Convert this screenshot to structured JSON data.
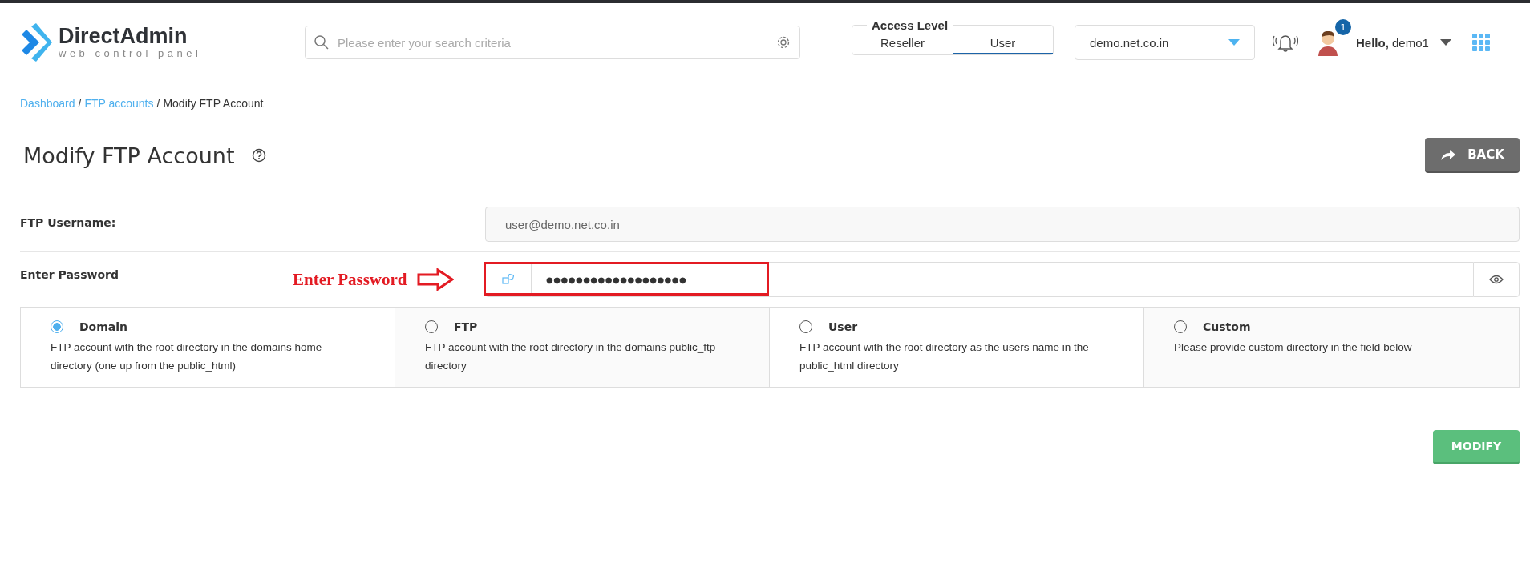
{
  "header": {
    "logo": {
      "name": "DirectAdmin",
      "tagline": "web control panel"
    },
    "search": {
      "placeholder": "Please enter your search criteria"
    },
    "access_level": {
      "title": "Access Level",
      "tabs": [
        {
          "label": "Reseller",
          "selected": false
        },
        {
          "label": "User",
          "selected": true
        }
      ]
    },
    "domain_select": {
      "value": "demo.net.co.in"
    },
    "notification_count": "1",
    "greeting": {
      "prefix": "Hello,",
      "user": "demo1"
    }
  },
  "breadcrumb": {
    "separator": "/",
    "items": [
      {
        "label": "Dashboard",
        "kind": "link"
      },
      {
        "label": "FTP accounts",
        "kind": "link"
      },
      {
        "label": "Modify FTP Account",
        "kind": "current"
      }
    ]
  },
  "page": {
    "title": "Modify FTP Account",
    "back_button": "BACK"
  },
  "form": {
    "username": {
      "label": "FTP Username:",
      "value": "user@demo.net.co.in"
    },
    "password": {
      "label": "Enter Password",
      "value": "●●●●●●●●●●●●●●●●●●●"
    },
    "annotation": "Enter Password"
  },
  "directory_options": [
    {
      "label": "Domain",
      "description": "FTP account with the root directory in the domains home directory (one up from the public_html)",
      "selected": true
    },
    {
      "label": "FTP",
      "description": "FTP account with the root directory in the domains public_ftp directory",
      "selected": false
    },
    {
      "label": "User",
      "description": "FTP account with the root directory as the users name in the public_html directory",
      "selected": false
    },
    {
      "label": "Custom",
      "description": "Please provide custom directory in the field below",
      "selected": false
    }
  ],
  "modify_button": "MODIFY"
}
